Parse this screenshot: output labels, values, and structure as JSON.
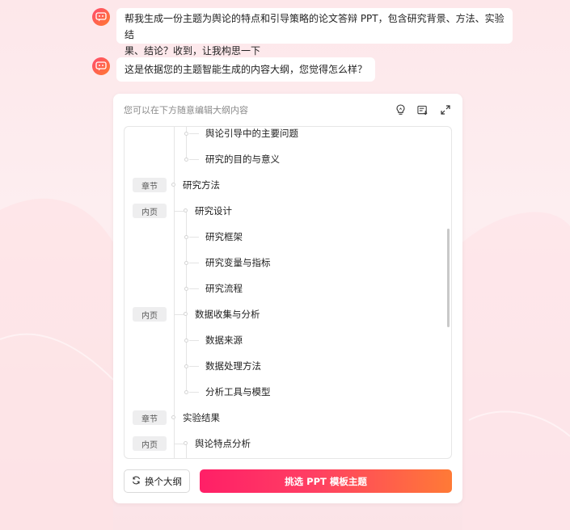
{
  "messages": [
    {
      "role": "assistant",
      "text_line1": "帮我生成一份主题为舆论的特点和引导策略的论文答辩 PPT，包含研究背景、方法、实验结",
      "text_line2": "果、结论？收到，让我构思一下"
    },
    {
      "role": "assistant",
      "text": "这是依据您的主题智能生成的内容大纲，您觉得怎么样？"
    }
  ],
  "outline_card": {
    "hint": "您可以在下方随意编辑大纲内容",
    "tools": [
      "lightbulb-icon",
      "document-export-icon",
      "expand-icon"
    ],
    "items": [
      {
        "level": 3,
        "tag": "",
        "text": "舆论引导中的主要问题"
      },
      {
        "level": 3,
        "tag": "",
        "text": "研究的目的与意义"
      },
      {
        "level": 1,
        "tag": "章节",
        "text": "研究方法"
      },
      {
        "level": 2,
        "tag": "内页",
        "text": "研究设计"
      },
      {
        "level": 3,
        "tag": "",
        "text": "研究框架"
      },
      {
        "level": 3,
        "tag": "",
        "text": "研究变量与指标"
      },
      {
        "level": 3,
        "tag": "",
        "text": "研究流程"
      },
      {
        "level": 2,
        "tag": "内页",
        "text": "数据收集与分析"
      },
      {
        "level": 3,
        "tag": "",
        "text": "数据来源"
      },
      {
        "level": 3,
        "tag": "",
        "text": "数据处理方法"
      },
      {
        "level": 3,
        "tag": "",
        "text": "分析工具与模型"
      },
      {
        "level": 1,
        "tag": "章节",
        "text": "实验结果"
      },
      {
        "level": 2,
        "tag": "内页",
        "text": "舆论特点分析"
      }
    ],
    "change_button": "换个大纲",
    "primary_button": "挑选 PPT 模板主题"
  }
}
